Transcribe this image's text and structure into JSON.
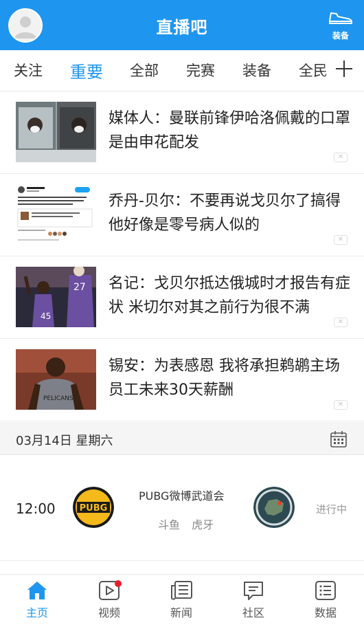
{
  "header": {
    "title": "直播吧",
    "right_button_label": "装备",
    "brand_color": "#1e96f0"
  },
  "tabs": [
    {
      "label": "关注",
      "active": false
    },
    {
      "label": "重要",
      "active": true
    },
    {
      "label": "全部",
      "active": false
    },
    {
      "label": "完赛",
      "active": false
    },
    {
      "label": "装备",
      "active": false
    },
    {
      "label": "全民",
      "active": false
    }
  ],
  "news": [
    {
      "title": "媒体人：曼联前锋伊哈洛佩戴的口罩是由申花配发",
      "thumb_icon": "masked-player-photo"
    },
    {
      "title": "乔丹-贝尔：不要再说戈贝尔了搞得他好像是零号病人似的",
      "thumb_icon": "tweet-screenshot"
    },
    {
      "title": "名记：戈贝尔抵达俄城时才报告有症状 米切尔对其之前行为很不满",
      "thumb_icon": "jazz-players-photo"
    },
    {
      "title": "锡安：为表感恩 我将承担鹈鹕主场员工未来30天薪酬",
      "thumb_icon": "zion-photo"
    }
  ],
  "schedule": {
    "date": "03月14日 星期六",
    "match": {
      "time": "12:00",
      "name": "PUBG微博武道会",
      "platforms": [
        "斗鱼",
        "虎牙"
      ],
      "status": "进行中",
      "left_logo": "pubg-logo",
      "right_logo": "map-logo"
    }
  },
  "bottom_nav": [
    {
      "label": "主页",
      "icon": "home-icon",
      "active": true
    },
    {
      "label": "视频",
      "icon": "video-icon",
      "active": false,
      "badge": true
    },
    {
      "label": "新闻",
      "icon": "news-icon",
      "active": false
    },
    {
      "label": "社区",
      "icon": "community-icon",
      "active": false
    },
    {
      "label": "数据",
      "icon": "data-icon",
      "active": false
    }
  ],
  "close_glyph": "✕"
}
